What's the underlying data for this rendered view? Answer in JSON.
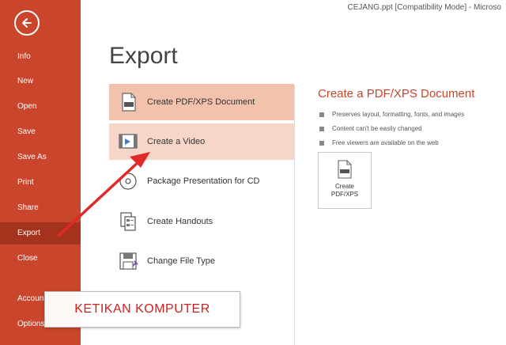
{
  "window": {
    "title": "CEJANG.ppt [Compatibility Mode] - Microso"
  },
  "sidebar": {
    "items": [
      {
        "label": "Info"
      },
      {
        "label": "New"
      },
      {
        "label": "Open"
      },
      {
        "label": "Save"
      },
      {
        "label": "Save As"
      },
      {
        "label": "Print"
      },
      {
        "label": "Share"
      },
      {
        "label": "Export",
        "selected": true
      },
      {
        "label": "Close"
      },
      {
        "label": "Account"
      },
      {
        "label": "Options"
      }
    ],
    "bg_color": "#c9452b",
    "selected_color": "#a5321c"
  },
  "page": {
    "title": "Export"
  },
  "options": [
    {
      "label": "Create PDF/XPS Document",
      "icon": "pdf-document-icon",
      "state": "selected"
    },
    {
      "label": "Create a Video",
      "icon": "video-icon",
      "state": "hover"
    },
    {
      "label": "Package Presentation for CD",
      "icon": "cd-icon",
      "state": "normal"
    },
    {
      "label": "Create Handouts",
      "icon": "handouts-icon",
      "state": "normal"
    },
    {
      "label": "Change File Type",
      "icon": "file-type-icon",
      "state": "normal"
    }
  ],
  "detail": {
    "title": "Create a PDF/XPS Document",
    "bullets": [
      "Preserves layout, formatting, fonts, and images",
      "Content can't be easily changed",
      "Free viewers are available on the web"
    ],
    "button_label_1": "Create",
    "button_label_2": "PDF/XPS"
  },
  "watermark": {
    "text": "KETIKAN KOMPUTER",
    "color": "#d02020"
  },
  "accent_color": "#c9452b"
}
